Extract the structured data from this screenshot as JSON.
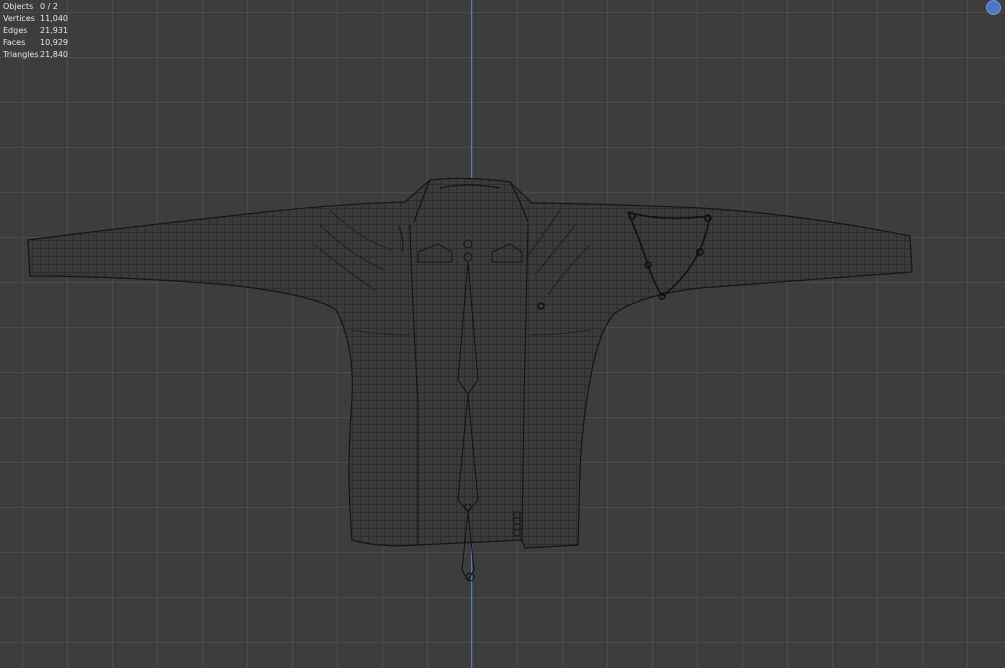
{
  "viewport": {
    "stats": [
      {
        "label": "Objects",
        "value": "0 / 2"
      },
      {
        "label": "Vertices",
        "value": "11,040"
      },
      {
        "label": "Edges",
        "value": "21,931"
      },
      {
        "label": "Faces",
        "value": "10,929"
      },
      {
        "label": "Triangles",
        "value": "21,840"
      }
    ],
    "axis_color": "#4f7fb8",
    "gizmo_color": "#4d77c5"
  }
}
